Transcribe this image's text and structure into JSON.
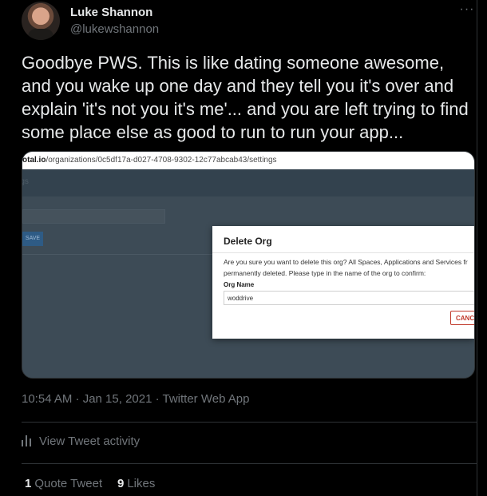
{
  "author": {
    "name": "Luke Shannon",
    "handle": "@lukewshannon"
  },
  "icons": {
    "more": "more-icon",
    "activity": "bar-chart-icon"
  },
  "tweet": {
    "text": "Goodbye PWS. This is like dating someone awesome, and you wake up one day and they tell you it's over and explain 'it's not you it's me'... and you are left trying to find some place else as good to run to run your app..."
  },
  "screenshot": {
    "url_domain": "otal.io",
    "url_path": "/organizations/0c5df17a-d027-4708-9302-12c77abcab43/settings",
    "modal": {
      "title": "Delete Org",
      "message_line1": "Are you sure you want to delete this org? All Spaces, Applications and Services fr",
      "message_line2": "permanently deleted. Please type in the name of the org to confirm:",
      "field_label": "Org Name",
      "field_value": "woddrive",
      "cancel_label": "CANC"
    }
  },
  "meta": {
    "timestamp": "10:54 AM · Jan 15, 2021 · Twitter Web App"
  },
  "activity_label": "View Tweet activity",
  "stats": {
    "quote_count": "1",
    "quote_label": "Quote Tweet",
    "like_count": "9",
    "like_label": "Likes"
  }
}
